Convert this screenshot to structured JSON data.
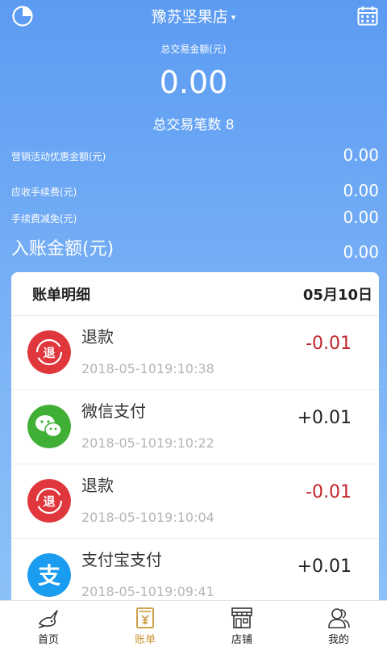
{
  "header": {
    "store_name": "豫苏坚果店",
    "caret": "▾"
  },
  "summary": {
    "total_amount_label": "总交易金额(元)",
    "total_amount_value": "0.00",
    "total_count_label": "总交易笔数",
    "total_count_value": "8"
  },
  "stats": [
    {
      "label": "营销活动优惠金额(元)",
      "value": "0.00"
    },
    {
      "label": "应收手续费(元)",
      "value": "0.00"
    },
    {
      "label": "手续费减免(元)",
      "value": "0.00"
    },
    {
      "label": "入账金额(元)",
      "value": "0.00"
    }
  ],
  "bill": {
    "title": "账单明细",
    "date": "05月10日",
    "transactions": [
      {
        "icon": "refund-icon",
        "badge": "退",
        "name": "退款",
        "time": "2018-05-1019:10:38",
        "amount": "-0.01"
      },
      {
        "icon": "wechat-pay-icon",
        "name": "微信支付",
        "time": "2018-05-1019:10:22",
        "amount": "+0.01"
      },
      {
        "icon": "refund-icon",
        "badge": "退",
        "name": "退款",
        "time": "2018-05-1019:10:04",
        "amount": "-0.01"
      },
      {
        "icon": "alipay-icon",
        "badge": "支",
        "name": "支付宝支付",
        "time": "2018-05-1019:09:41",
        "amount": "+0.01"
      }
    ]
  },
  "nav": {
    "items": [
      {
        "label": "首页",
        "icon": "bird-icon"
      },
      {
        "label": "账单",
        "icon": "bill-icon",
        "active": true
      },
      {
        "label": "店铺",
        "icon": "store-icon"
      },
      {
        "label": "我的",
        "icon": "user-icon"
      }
    ]
  },
  "colors": {
    "accent_blue": "#5b9bf2",
    "refund_red": "#e0373d",
    "wechat_green": "#3fb035",
    "alipay_blue": "#1a9cf0",
    "nav_active": "#c99838",
    "negative_amount": "#c1272d"
  }
}
